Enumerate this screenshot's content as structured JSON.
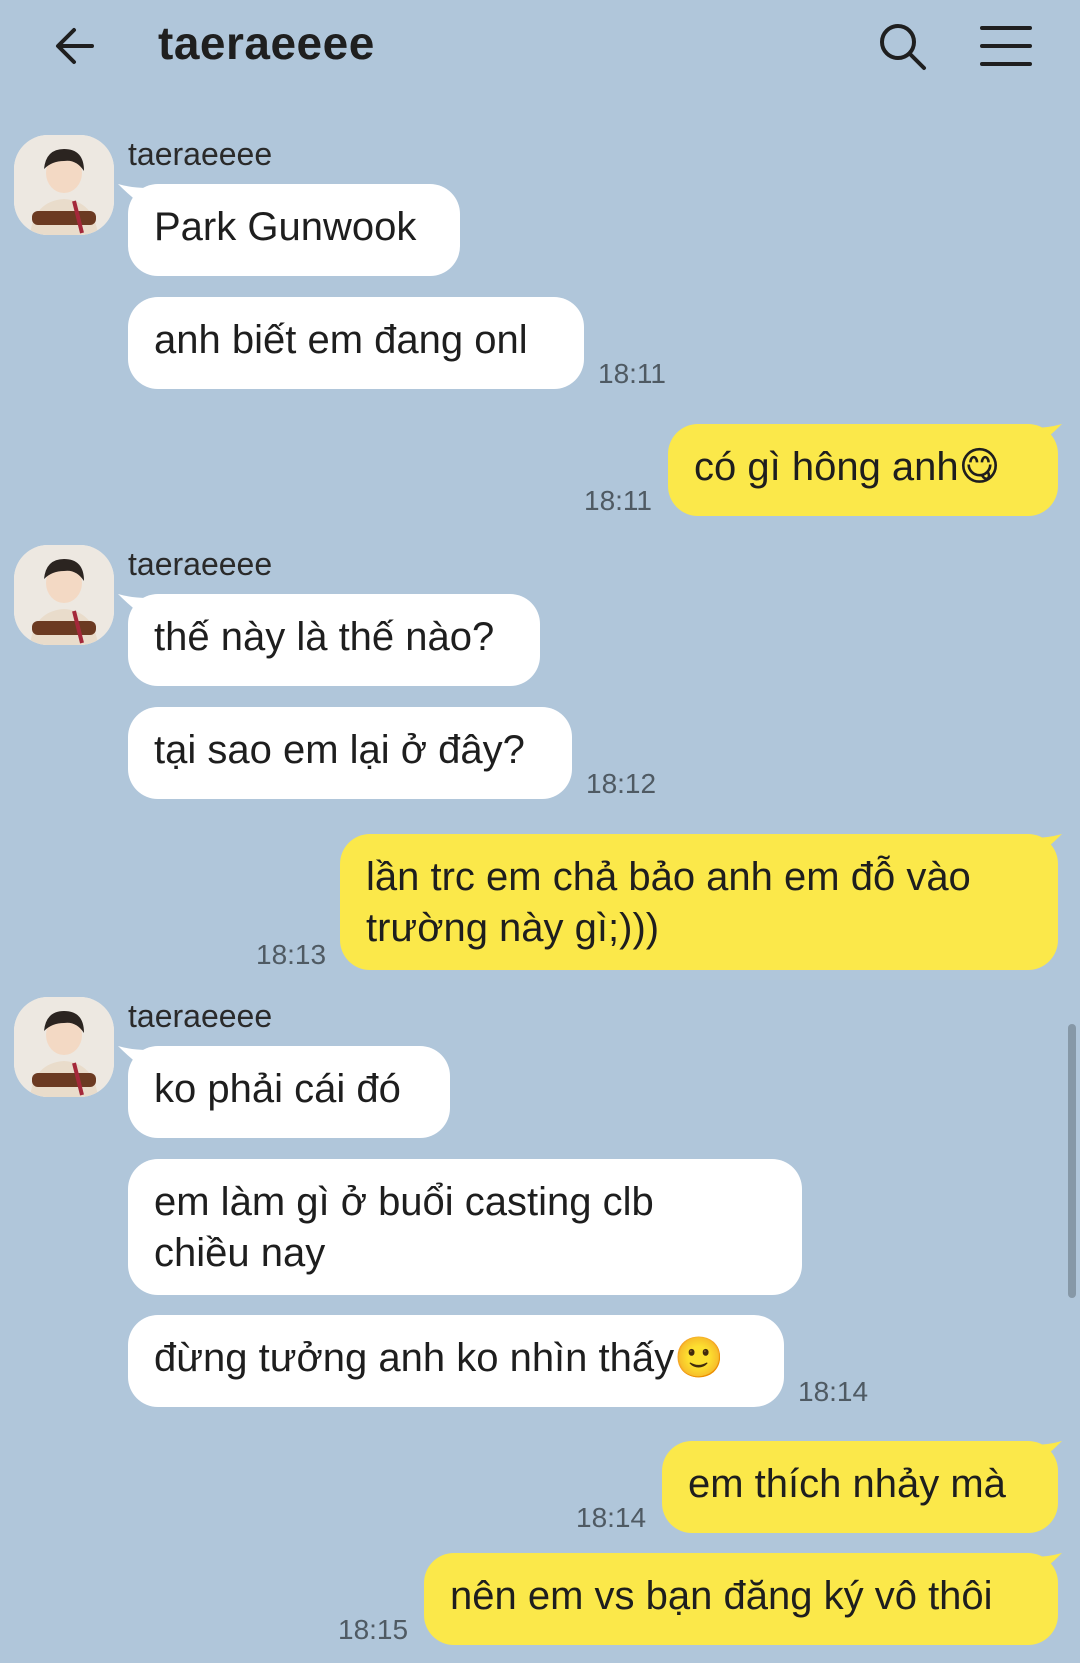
{
  "header": {
    "title": "taeraeeee",
    "back_icon": "arrow-left-icon",
    "search_icon": "search-icon",
    "menu_icon": "hamburger-menu-icon"
  },
  "colors": {
    "background": "#b0c6da",
    "incoming_bubble": "#ffffff",
    "outgoing_bubble": "#fbe84a"
  },
  "messages": [
    {
      "sender": "taeraeeee",
      "text": "Park Gunwook"
    },
    {
      "text": "anh biết em đang onl",
      "time": "18:11"
    },
    {
      "text": "có gì hông anh",
      "emoji": "😋",
      "time": "18:11"
    },
    {
      "sender": "taeraeeee",
      "text": "thế này là thế nào?"
    },
    {
      "text": "tại sao em lại ở đây?",
      "time": "18:12"
    },
    {
      "line1": "lần trc em chả bảo anh em đỗ vào",
      "line2": "trường này gì;)))",
      "time": "18:13"
    },
    {
      "sender": "taeraeeee",
      "text": "ko phải cái đó"
    },
    {
      "line1": "em làm gì ở buổi casting clb",
      "line2": "chiều nay"
    },
    {
      "text": "đừng tưởng anh ko nhìn thấy",
      "emoji": "🙂",
      "time": "18:14"
    },
    {
      "text": "em thích nhảy mà",
      "time": "18:14"
    },
    {
      "text": "nên em vs bạn đăng ký vô thôi",
      "time": "18:15"
    }
  ]
}
